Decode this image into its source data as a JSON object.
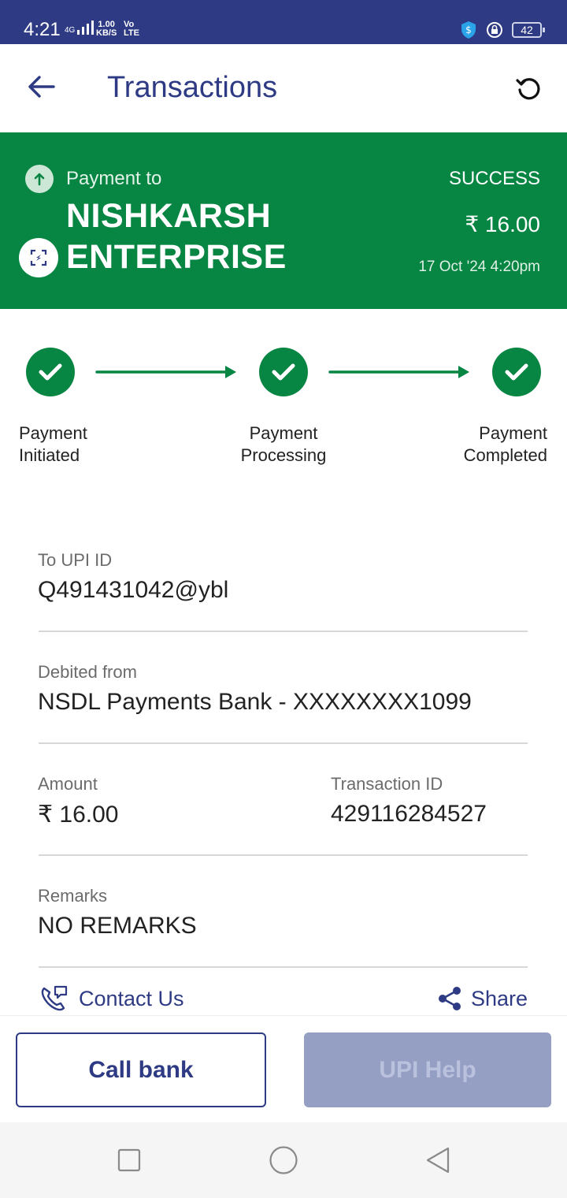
{
  "status_bar": {
    "time": "4:21",
    "network": "4G",
    "speed_value": "1.00",
    "speed_unit": "KB/S",
    "volte_top": "Vo",
    "volte_bottom": "LTE",
    "battery": "42"
  },
  "app_bar": {
    "title": "Transactions",
    "back_icon": "arrow-left-icon",
    "refresh_icon": "refresh-icon"
  },
  "hero": {
    "payment_to_label": "Payment to",
    "merchant_name": "NISHKARSH ENTERPRISE",
    "status": "SUCCESS",
    "amount": "₹ 16.00",
    "date": "17 Oct '24 4:20pm",
    "background_color": "#078542"
  },
  "steps": [
    {
      "line1": "Payment",
      "line2": "Initiated"
    },
    {
      "line1": "Payment",
      "line2": "Processing"
    },
    {
      "line1": "Payment",
      "line2": "Completed"
    }
  ],
  "details": {
    "upi_id_label": "To UPI ID",
    "upi_id": "Q491431042@ybl",
    "debited_label": "Debited from",
    "debited_value": "NSDL Payments Bank - XXXXXXXX1099",
    "amount_label": "Amount",
    "amount_value": "₹ 16.00",
    "txn_id_label": "Transaction ID",
    "txn_id_value": "429116284527",
    "remarks_label": "Remarks",
    "remarks_value": "NO REMARKS"
  },
  "actions": {
    "contact_label": "Contact Us",
    "share_label": "Share",
    "call_bank_label": "Call bank",
    "upi_help_label": "UPI Help"
  },
  "colors": {
    "primary": "#2e3b84",
    "success": "#078542",
    "disabled_button": "#959fc4"
  }
}
